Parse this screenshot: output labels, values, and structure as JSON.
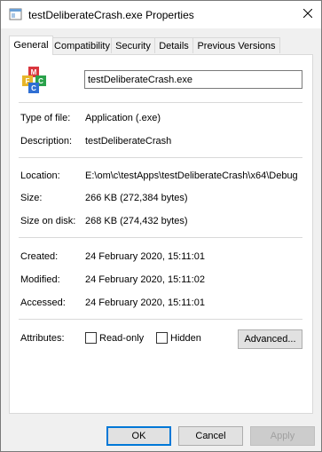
{
  "window": {
    "title": "testDeliberateCrash.exe Properties"
  },
  "tabs": [
    {
      "label": "General"
    },
    {
      "label": "Compatibility"
    },
    {
      "label": "Security"
    },
    {
      "label": "Details"
    },
    {
      "label": "Previous Versions"
    }
  ],
  "general": {
    "file_name": "testDeliberateCrash.exe",
    "type_label": "Type of file:",
    "type_value": "Application (.exe)",
    "description_label": "Description:",
    "description_value": "testDeliberateCrash",
    "location_label": "Location:",
    "location_value": "E:\\om\\c\\testApps\\testDeliberateCrash\\x64\\Debug",
    "size_label": "Size:",
    "size_value": "266 KB (272,384 bytes)",
    "size_on_disk_label": "Size on disk:",
    "size_on_disk_value": "268 KB (274,432 bytes)",
    "created_label": "Created:",
    "created_value": "24 February 2020, 15:11:01",
    "modified_label": "Modified:",
    "modified_value": "24 February 2020, 15:11:02",
    "accessed_label": "Accessed:",
    "accessed_value": "24 February 2020, 15:11:01",
    "attributes_label": "Attributes:",
    "readonly_label": "Read-only",
    "hidden_label": "Hidden",
    "advanced_label": "Advanced...",
    "readonly_checked": false,
    "hidden_checked": false
  },
  "buttons": {
    "ok": "OK",
    "cancel": "Cancel",
    "apply": "Apply"
  },
  "icons": {
    "app": "app-icon",
    "close": "close-icon",
    "file_type": "exe-file-icon"
  },
  "colors": {
    "accent": "#0078d7",
    "panel_bg": "#ffffff",
    "window_bg": "#f0f0f0"
  }
}
